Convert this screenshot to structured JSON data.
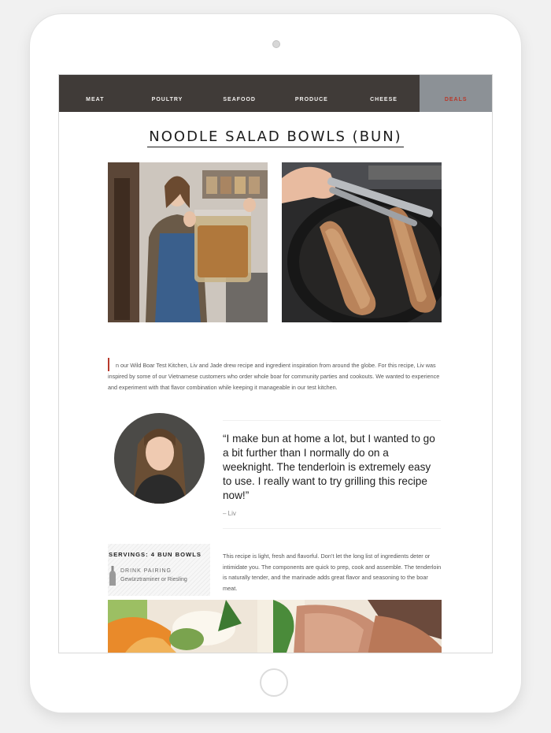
{
  "nav": {
    "items": [
      {
        "label": "MEAT"
      },
      {
        "label": "POULTRY"
      },
      {
        "label": "SEAFOOD"
      },
      {
        "label": "PRODUCE"
      },
      {
        "label": "CHEESE"
      },
      {
        "label": "DEALS"
      }
    ]
  },
  "page": {
    "title": "NOODLE SALAD BOWLS (BUN)"
  },
  "intro": {
    "text": "n our Wild Boar Test Kitchen, Liv and Jade drew recipe and ingredient inspiration from around the globe. For this recipe, Liv was inspired by some of our Vietnamese customers who order whole boar for community parties and cookouts. We wanted to experience and experiment with that flavor combination while keeping it manageable in our test kitchen."
  },
  "quote": {
    "text": "“I make bun at home a lot, but I wanted to go a bit further than I normally do on a weeknight. The tenderloin is extremely easy to use. I really want to try grilling this recipe now!”",
    "author": "– Liv"
  },
  "recipe": {
    "servings": "SERVINGS: 4 BUN BOWLS",
    "pairing_label": "DRINK PAIRING",
    "pairing_value": "Gewürztraminer or Riesling",
    "description": "This recipe is light, fresh and flavorful. Don’t let the long list of ingredients deter or intimidate you. The components are quick to prep, cook and assemble. The tenderloin is naturally tender, and the marinade adds great flavor and seasoning to the boar meat."
  },
  "colors": {
    "nav_bg": "#403b38",
    "deals_bg": "#8c9196",
    "deals_text": "#b8392b",
    "accent": "#b8392b"
  },
  "icons": {
    "drink_pairing": "wine-bottle-icon"
  }
}
